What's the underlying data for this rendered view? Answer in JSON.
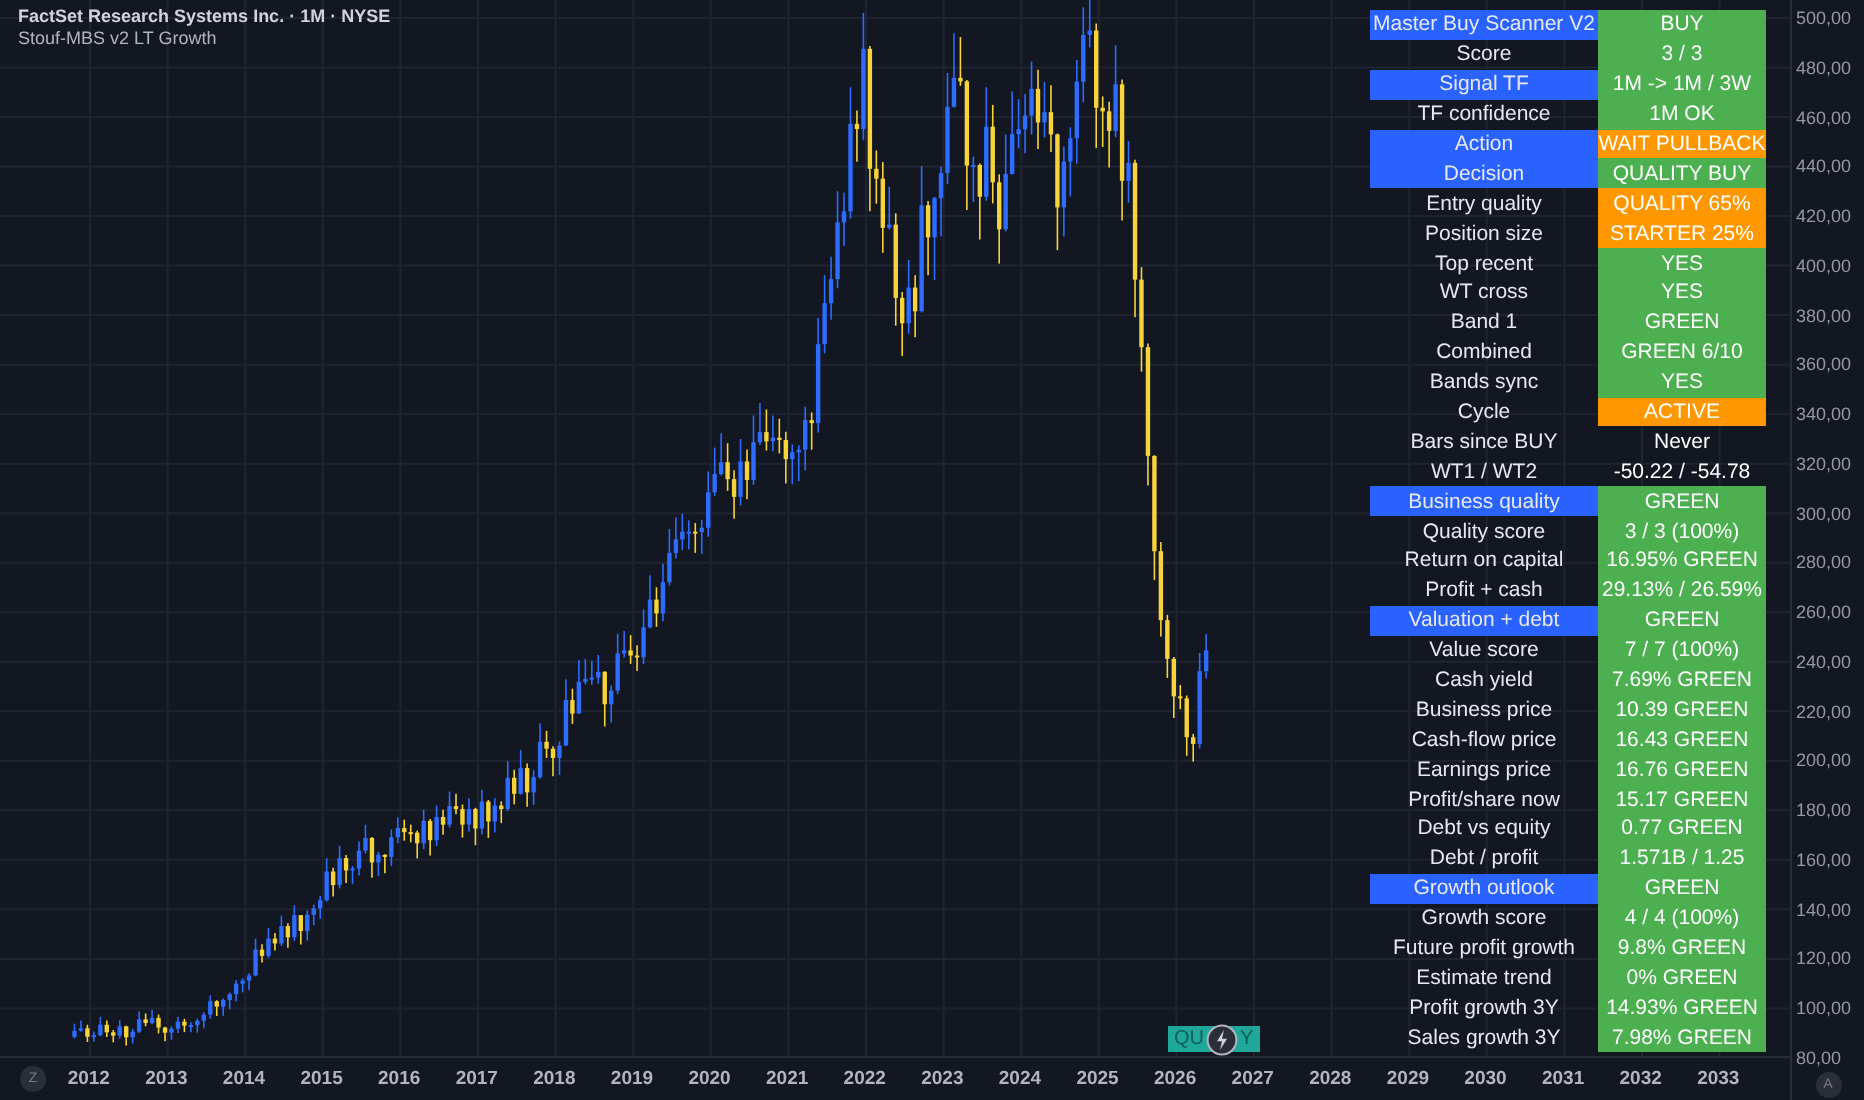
{
  "header": {
    "title": "FactSet Research Systems Inc. · 1M · NYSE",
    "indicator": "Stouf-MBS v2 LT Growth"
  },
  "scanner": {
    "rows": [
      {
        "label": "Master Buy Scanner V2",
        "header": true,
        "value": "BUY",
        "color": "#4caf50"
      },
      {
        "label": "Score",
        "header": false,
        "value": "3 / 3",
        "color": "#4caf50"
      },
      {
        "label": "Signal TF",
        "header": true,
        "value": "1M -> 1M / 3W",
        "color": "#4caf50"
      },
      {
        "label": "TF confidence",
        "header": false,
        "value": "1M OK",
        "color": "#4caf50"
      },
      {
        "label": "Action",
        "header": true,
        "value": "WAIT PULLBACK",
        "color": "#ff9800"
      },
      {
        "label": "Decision",
        "header": true,
        "value": "QUALITY BUY",
        "color": "#4caf50"
      },
      {
        "label": "Entry quality",
        "header": false,
        "value": "QUALITY 65%",
        "color": "#ff9800"
      },
      {
        "label": "Position size",
        "header": false,
        "value": "STARTER 25%",
        "color": "#ff9800"
      },
      {
        "label": "Top recent",
        "header": false,
        "value": "YES",
        "color": "#4caf50"
      },
      {
        "label": "WT cross",
        "header": false,
        "value": "YES",
        "color": "#4caf50"
      },
      {
        "label": "Band 1",
        "header": false,
        "value": "GREEN",
        "color": "#4caf50"
      },
      {
        "label": "Combined",
        "header": false,
        "value": "GREEN 6/10",
        "color": "#4caf50"
      },
      {
        "label": "Bands sync",
        "header": false,
        "value": "YES",
        "color": "#4caf50"
      },
      {
        "label": "Cycle",
        "header": false,
        "value": "ACTIVE",
        "color": "#ff9800"
      },
      {
        "label": "Bars since BUY",
        "header": false,
        "value": "Never"
      },
      {
        "label": "WT1 / WT2",
        "header": false,
        "value": "-50.22 / -54.78"
      },
      {
        "label": "Business quality",
        "header": true,
        "value": "GREEN",
        "color": "#4caf50"
      },
      {
        "label": "Quality score",
        "header": false,
        "value": "3 / 3 (100%)",
        "color": "#4caf50"
      },
      {
        "label": "Return on capital",
        "header": false,
        "value": "16.95% GREEN",
        "color": "#4caf50"
      },
      {
        "label": "Profit + cash",
        "header": false,
        "value": "29.13% / 26.59%",
        "color": "#4caf50"
      },
      {
        "label": "Valuation + debt",
        "header": true,
        "value": "GREEN",
        "color": "#4caf50"
      },
      {
        "label": "Value score",
        "header": false,
        "value": "7 / 7 (100%)",
        "color": "#4caf50"
      },
      {
        "label": "Cash yield",
        "header": false,
        "value": "7.69% GREEN",
        "color": "#4caf50"
      },
      {
        "label": "Business price",
        "header": false,
        "value": "10.39 GREEN",
        "color": "#4caf50"
      },
      {
        "label": "Cash-flow price",
        "header": false,
        "value": "16.43 GREEN",
        "color": "#4caf50"
      },
      {
        "label": "Earnings price",
        "header": false,
        "value": "16.76 GREEN",
        "color": "#4caf50"
      },
      {
        "label": "Profit/share now",
        "header": false,
        "value": "15.17 GREEN",
        "color": "#4caf50"
      },
      {
        "label": "Debt vs equity",
        "header": false,
        "value": "0.77 GREEN",
        "color": "#4caf50"
      },
      {
        "label": "Debt / profit",
        "header": false,
        "value": "1.571B / 1.25",
        "color": "#4caf50"
      },
      {
        "label": "Growth outlook",
        "header": true,
        "value": "GREEN",
        "color": "#4caf50"
      },
      {
        "label": "Growth score",
        "header": false,
        "value": "4 / 4 (100%)",
        "color": "#4caf50"
      },
      {
        "label": "Future profit growth",
        "header": false,
        "value": "9.8% GREEN",
        "color": "#4caf50"
      },
      {
        "label": "Estimate trend",
        "header": false,
        "value": "0% GREEN",
        "color": "#4caf50"
      },
      {
        "label": "Profit growth 3Y",
        "header": false,
        "value": "14.93% GREEN",
        "color": "#4caf50"
      },
      {
        "label": "Sales growth 3Y",
        "header": false,
        "value": "7.98% GREEN",
        "color": "#4caf50"
      }
    ]
  },
  "signal_badge": {
    "text_start": "QU",
    "text_end": "Y"
  },
  "price_axis": {
    "labels": [
      "500,00",
      "480,00",
      "460,00",
      "440,00",
      "420,00",
      "400,00",
      "380,00",
      "360,00",
      "340,00",
      "320,00",
      "300,00",
      "280,00",
      "260,00",
      "240,00",
      "220,00",
      "200,00",
      "180,00",
      "160,00",
      "140,00",
      "120,00",
      "100,00",
      "80,00"
    ],
    "auto_button": "A"
  },
  "time_axis": {
    "zoom_button": "Z",
    "labels": [
      "2012",
      "2013",
      "2014",
      "2015",
      "2016",
      "2017",
      "2018",
      "2019",
      "2020",
      "2021",
      "2022",
      "2023",
      "2024",
      "2025",
      "2026",
      "2027",
      "2028",
      "2029",
      "2030",
      "2031",
      "2032",
      "2033"
    ]
  }
}
